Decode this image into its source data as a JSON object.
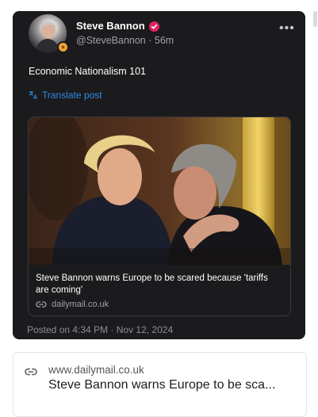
{
  "post": {
    "author_name": "Steve Bannon",
    "handle": "@SteveBannon",
    "separator": "·",
    "time_ago": "56m",
    "text": "Economic Nationalism 101",
    "translate_label": "Translate post",
    "link_card": {
      "title": "Steve Bannon warns Europe to be scared because 'tariffs are coming'",
      "domain": "dailymail.co.uk"
    },
    "posted_on": "Posted on 4:34 PM · Nov 12, 2024"
  },
  "preview": {
    "domain": "www.dailymail.co.uk",
    "title": "Steve Bannon warns Europe to be sca..."
  },
  "icons": {
    "verified": "verified-badge-icon",
    "more": "more-options-icon",
    "translate": "translate-icon",
    "link": "link-icon",
    "avatar_badge": "account-badge-icon"
  },
  "colors": {
    "card_background": "#1b1b1d",
    "accent_blue": "#2f8be6",
    "verified_red": "#e0245e",
    "badge_gold": "#f0a63a"
  }
}
